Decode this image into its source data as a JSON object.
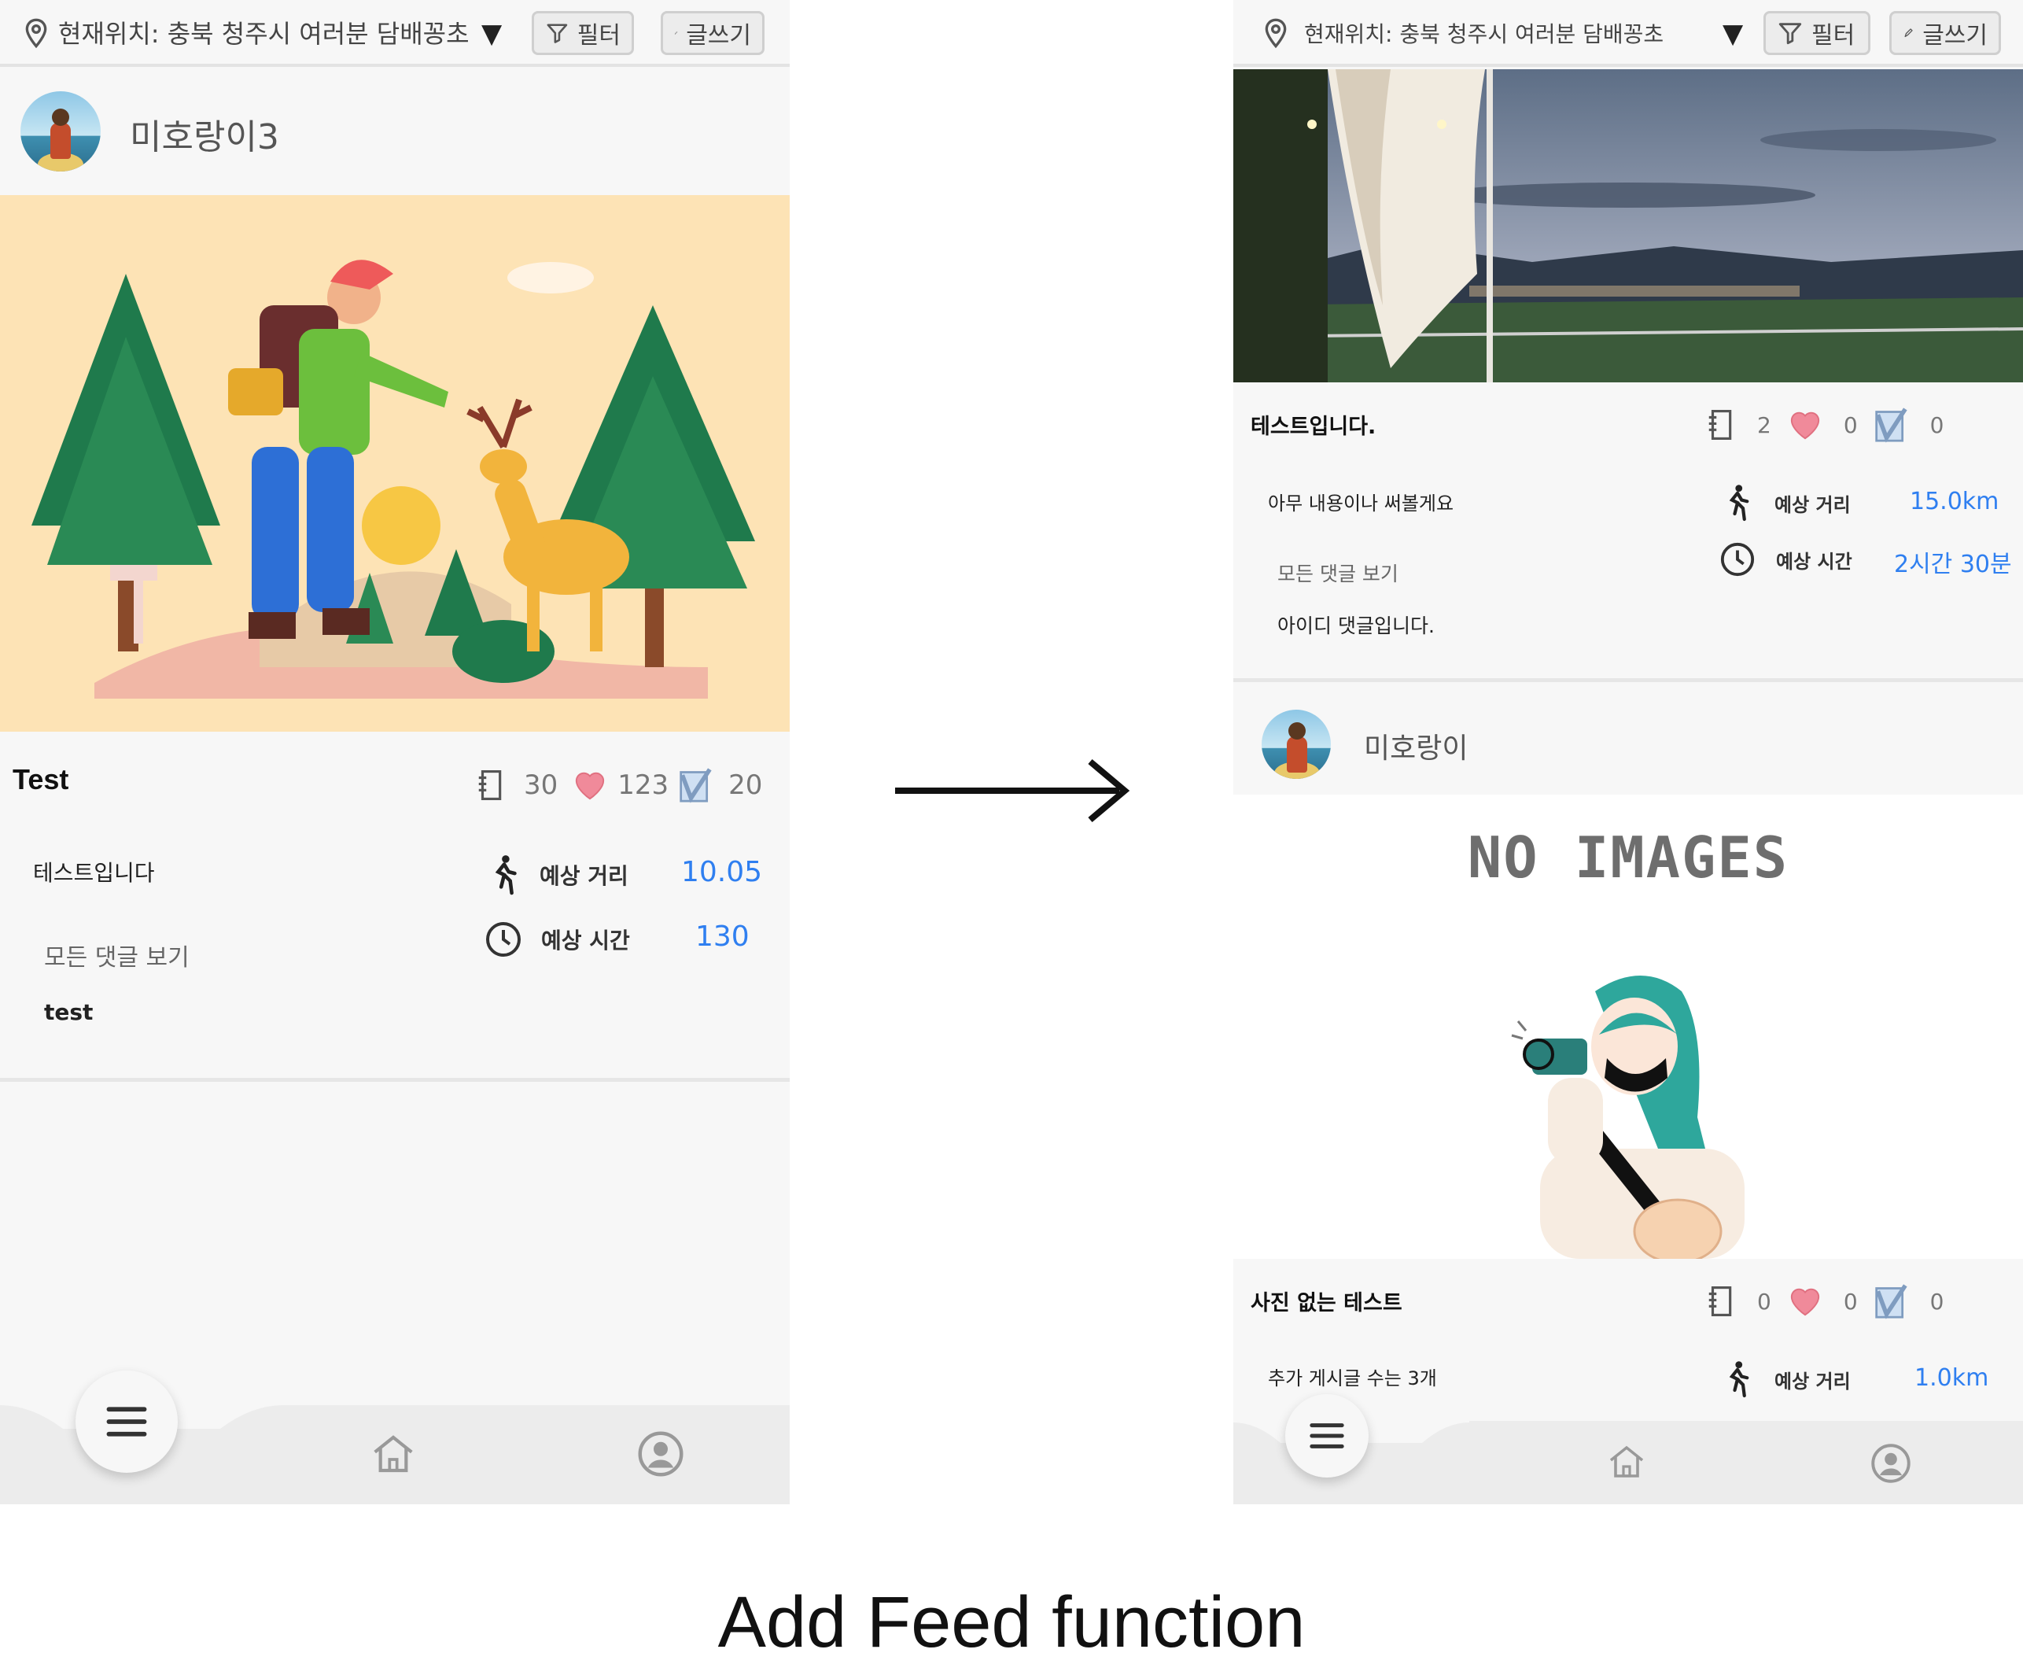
{
  "caption": "Add Feed function",
  "left": {
    "location_text": "현재위치: 충북 청주시 여러분 담배꽁초",
    "filter_label": "필터",
    "write_label": "글쓰기",
    "user_name": "미호랑이3",
    "post": {
      "title": "Test",
      "posts_count": "30",
      "likes_count": "123",
      "checks_count": "20",
      "body": "테스트입니다",
      "comments_link": "모든 댓글 보기",
      "comment": "test",
      "distance_label": "예상 거리",
      "distance_value": "10.05",
      "time_label": "예상 시간",
      "time_value": "130"
    }
  },
  "right": {
    "location_text": "현재위치: 충북 청주시 여러분 담배꽁초",
    "filter_label": "필터",
    "write_label": "글쓰기",
    "post1": {
      "title": "테스트입니다.",
      "posts_count": "2",
      "likes_count": "0",
      "checks_count": "0",
      "body": "아무 내용이나 써볼게요",
      "comments_link": "모든 댓글 보기",
      "comment": "아이디  댓글입니다.",
      "distance_label": "예상 거리",
      "distance_value": "15.0km",
      "time_label": "예상 시간",
      "time_value": "2시간 30분"
    },
    "user_name": "미호랑이",
    "no_images_text": "NO IMAGES",
    "post2": {
      "title": "사진 없는 테스트",
      "posts_count": "0",
      "likes_count": "0",
      "checks_count": "0",
      "body": "추가 게시글 수는 3개",
      "distance_label": "예상 거리",
      "distance_value": "1.0km"
    }
  },
  "icons": [
    "location-pin-icon",
    "filter-icon",
    "pencil-icon",
    "notebook-icon",
    "heart-icon",
    "check-icon",
    "walking-icon",
    "clock-icon",
    "menu-icon",
    "home-icon",
    "profile-icon",
    "arrow-right-icon"
  ],
  "colors": {
    "accent_blue": "#2f7ff0",
    "heart_pink": "#f08a9a",
    "background": "#f7f7f7",
    "illustration_bg": "#fde3b5"
  }
}
